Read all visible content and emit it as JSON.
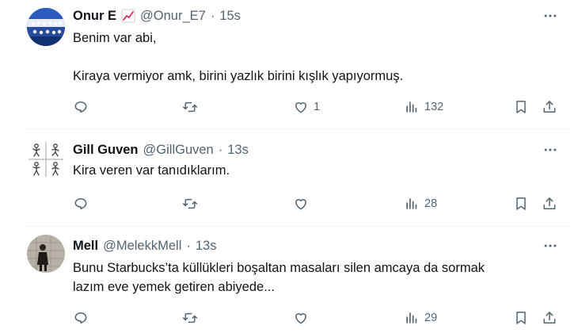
{
  "colors": {
    "text": "#0f1419",
    "muted": "#536471",
    "divider": "#eff3f4"
  },
  "tweets": [
    {
      "name": "Onur E",
      "badge_icon": "chart-increasing-emoji",
      "handle": "@Onur_E7",
      "time": "15s",
      "text": "Benim var abi,\n\nKiraya vermiyor amk, birini yazlık birini kışlık yapıyormuş.",
      "likes": "1",
      "views": "132"
    },
    {
      "name": "Gill Guven",
      "handle": "@GillGuven",
      "time": "13s",
      "text": "Kira veren var tanıdıklarım.",
      "views": "28"
    },
    {
      "name": "Mell",
      "handle": "@MelekkMell",
      "time": "13s",
      "text": "Bunu Starbucks’ta küllükleri boşaltan masaları silen amcaya da sormak\nlazım eve yemek getiren abiyede...",
      "views": "29"
    }
  ],
  "separator": "·"
}
